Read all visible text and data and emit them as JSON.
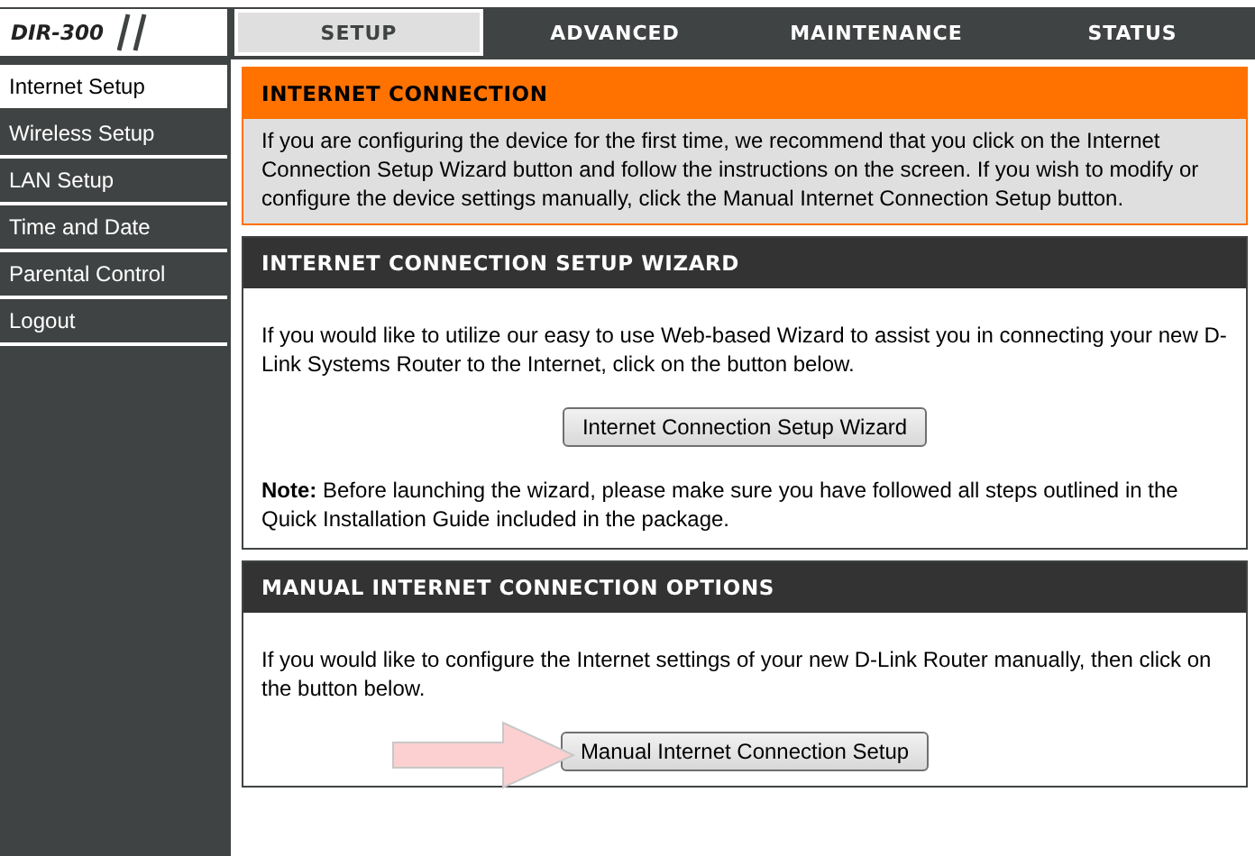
{
  "logo": {
    "model": "DIR-300"
  },
  "tabs": [
    {
      "label": "SETUP",
      "selected": true
    },
    {
      "label": "ADVANCED",
      "selected": false
    },
    {
      "label": "MAINTENANCE",
      "selected": false
    },
    {
      "label": "STATUS",
      "selected": false
    }
  ],
  "sidebar": {
    "items": [
      {
        "label": "Internet Setup",
        "selected": true
      },
      {
        "label": "Wireless Setup",
        "selected": false
      },
      {
        "label": "LAN Setup",
        "selected": false
      },
      {
        "label": "Time and Date",
        "selected": false
      },
      {
        "label": "Parental Control",
        "selected": false
      },
      {
        "label": "Logout",
        "selected": false
      }
    ]
  },
  "sections": [
    {
      "kind": "notice",
      "title": "INTERNET CONNECTION",
      "paragraphs": [
        "If you are configuring the device for the first time, we recommend that you click on the Internet Connection Setup Wizard button and follow the instructions on the screen. If you wish to modify or configure the device settings manually, click the Manual Internet Connection Setup button."
      ]
    },
    {
      "kind": "panel",
      "title": "INTERNET CONNECTION SETUP WIZARD",
      "paragraphs": [
        "If you would like to utilize our easy to use Web-based Wizard to assist you in connecting your new D-Link Systems Router to the Internet, click on the button below."
      ],
      "button": "Internet Connection Setup Wizard",
      "arrow": false,
      "note": "**Note:** Before launching the wizard, please make sure you have followed all steps outlined in the Quick Installation Guide included in the package."
    },
    {
      "kind": "panel",
      "title": "MANUAL INTERNET CONNECTION OPTIONS",
      "paragraphs": [
        "If you would like to configure the Internet settings of your new D-Link Router manually, then click on the button below."
      ],
      "button": "Manual Internet Connection Setup",
      "arrow": true
    }
  ]
}
